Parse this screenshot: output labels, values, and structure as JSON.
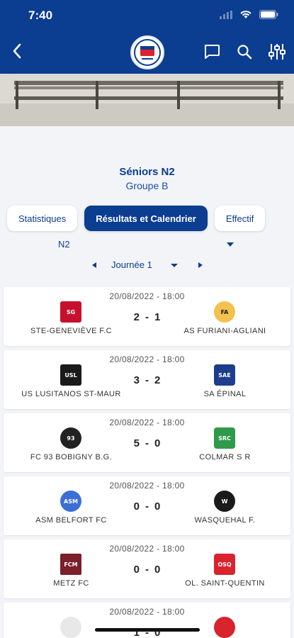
{
  "status": {
    "time": "7:40"
  },
  "header": {
    "logo_text": "FFF"
  },
  "competition": {
    "title": "Séniors N2",
    "group": "Groupe B"
  },
  "tabs": [
    {
      "label": "Statistiques",
      "active": false
    },
    {
      "label": "Résultats et Calendrier",
      "active": true
    },
    {
      "label": "Effectif",
      "active": false
    }
  ],
  "filters": {
    "competition_value": "N2",
    "day_label": "Journée 1"
  },
  "matches": [
    {
      "date": "20/08/2022 - 18:00",
      "home": "STE-GENEVIÈVE F.C",
      "away": "AS FURIANI-AGLIANI",
      "home_score": "2",
      "away_score": "1",
      "home_badge": "SG",
      "away_badge": "FA"
    },
    {
      "date": "20/08/2022 - 18:00",
      "home": "US LUSITANOS ST-MAUR",
      "away": "SA ÉPINAL",
      "home_score": "3",
      "away_score": "2",
      "home_badge": "USL",
      "away_badge": "SAE"
    },
    {
      "date": "20/08/2022 - 18:00",
      "home": "FC 93 BOBIGNY B.G.",
      "away": "COLMAR S R",
      "home_score": "5",
      "away_score": "0",
      "home_badge": "93",
      "away_badge": "SRC"
    },
    {
      "date": "20/08/2022 - 18:00",
      "home": "ASM BELFORT FC",
      "away": "WASQUEHAL F.",
      "home_score": "0",
      "away_score": "0",
      "home_badge": "ASM",
      "away_badge": "W"
    },
    {
      "date": "20/08/2022 - 18:00",
      "home": "METZ FC",
      "away": "OL. SAINT-QUENTIN",
      "home_score": "0",
      "away_score": "0",
      "home_badge": "FCM",
      "away_badge": "OSQ"
    },
    {
      "date": "20/08/2022 - 18:00",
      "home": "",
      "away": "",
      "home_score": "1",
      "away_score": "0",
      "home_badge": "",
      "away_badge": ""
    }
  ],
  "colors": {
    "primary": "#0b3d91",
    "background": "#f3f4f8"
  },
  "icons": {
    "back": "chevron-left-icon",
    "chat": "chat-icon",
    "search": "search-icon",
    "filter": "sliders-icon"
  }
}
